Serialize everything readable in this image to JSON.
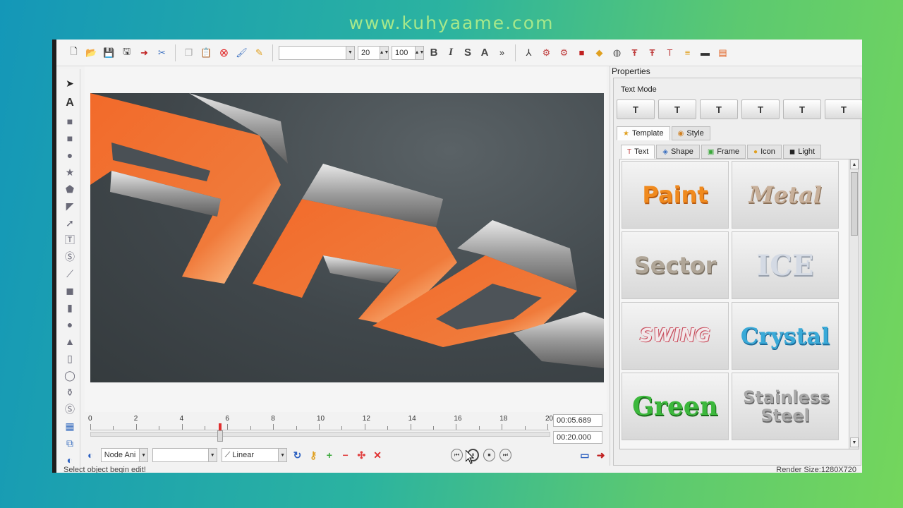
{
  "watermark": "www.kuhyaame.com",
  "toolbar": {
    "font_size": "20",
    "scale": "100",
    "bold": "B",
    "italic": "I",
    "shadow": "S",
    "outline": "A",
    "icons": [
      "new-icon",
      "open-icon",
      "save-icon",
      "save-as-icon",
      "export-icon",
      "cut-icon",
      "copy-icon",
      "paste-icon",
      "delete-icon",
      "brush-icon",
      "pencil-icon"
    ]
  },
  "palette": {
    "icons": [
      "select-arrow-icon",
      "text-icon",
      "rectangle-icon",
      "square-icon",
      "circle-icon",
      "star-icon",
      "pentagon-icon",
      "shield-icon",
      "arrow-icon",
      "text-box-icon",
      "s-shape-icon",
      "line-icon",
      "cube-icon",
      "cylinder-icon",
      "sphere-icon",
      "cone-icon",
      "pillar-icon",
      "ring-icon",
      "vase-icon",
      "s-block-icon",
      "image-icon",
      "group-icon",
      "rotate-icon"
    ]
  },
  "timeline": {
    "ticks": [
      "0",
      "2",
      "4",
      "6",
      "8",
      "10",
      "12",
      "14",
      "16",
      "18",
      "20"
    ],
    "current_time": "00:05.689",
    "total_time": "00:20.000",
    "playhead_seconds": 5.689,
    "duration_seconds": 20
  },
  "controls": {
    "node_anim": "Node Ani",
    "second_combo": "",
    "interpolation": "Linear"
  },
  "status": {
    "message": "Select object begin edit!",
    "render_size": "Render Size:1280X720"
  },
  "properties": {
    "title": "Properties",
    "text_mode_label": "Text Mode",
    "mode_buttons": [
      "T",
      "T",
      "T",
      "T",
      "T",
      "T"
    ],
    "top_tabs": [
      {
        "label": "Template",
        "icon": "star-icon"
      },
      {
        "label": "Style",
        "icon": "palette-icon"
      }
    ],
    "sub_tabs": [
      {
        "label": "Text",
        "icon": "text-icon"
      },
      {
        "label": "Shape",
        "icon": "shape-icon"
      },
      {
        "label": "Frame",
        "icon": "frame-icon"
      },
      {
        "label": "Icon",
        "icon": "icon-icon"
      },
      {
        "label": "Light",
        "icon": "light-icon"
      }
    ],
    "templates": [
      {
        "label": "Paint",
        "color": "#f08a1e"
      },
      {
        "label": "Metal",
        "color": "#b89f86"
      },
      {
        "label": "Sector",
        "color": "#a89e92"
      },
      {
        "label": "ICE",
        "color": "#c8ced8"
      },
      {
        "label": "SWING",
        "color": "#c84a5a"
      },
      {
        "label": "Crystal",
        "color": "#3aaad8"
      },
      {
        "label": "Green",
        "color": "#3cb83c"
      },
      {
        "label": "Stainless Steel",
        "color": "#9a9a9a"
      }
    ]
  },
  "accent_colors": {
    "orange": "#f06a2a",
    "metal": "#b4b4b4"
  }
}
